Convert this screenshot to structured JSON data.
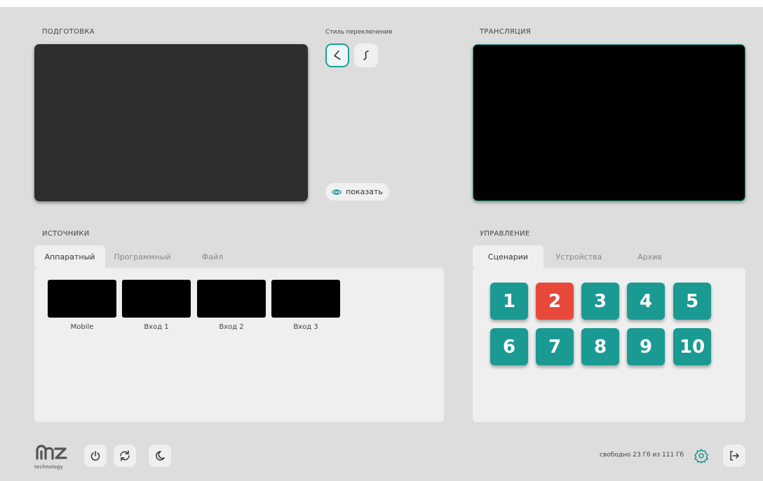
{
  "preview": {
    "label": "ПОДГОТОВКА"
  },
  "program": {
    "label": "ТРАНСЛЯЦИЯ"
  },
  "switch_style": {
    "label": "Стиль переключения",
    "options": [
      {
        "icon": "transition-cut-icon",
        "active": true
      },
      {
        "icon": "transition-fade-icon",
        "active": false
      }
    ]
  },
  "show_button": {
    "label": "показать",
    "icon": "eye-icon"
  },
  "sources": {
    "label": "ИСТОЧНИКИ",
    "tabs": [
      "Аппаратный",
      "Программный",
      "Файл"
    ],
    "active_tab": 0,
    "items": [
      "Mobile",
      "Вход 1",
      "Вход 2",
      "Вход 3"
    ]
  },
  "control": {
    "label": "УПРАВЛЕНИЕ",
    "tabs": [
      "Сценарии",
      "Устройства",
      "Архив"
    ],
    "active_tab": 0,
    "scenarios": [
      "1",
      "2",
      "3",
      "4",
      "5",
      "6",
      "7",
      "8",
      "9",
      "10"
    ],
    "active_scenario": "2"
  },
  "footer": {
    "logo_text": "technology",
    "storage_text": "свободно 23 Гб из 111 Гб",
    "buttons": [
      "power-icon",
      "refresh-icon",
      "moon-icon"
    ],
    "right_buttons": [
      "gear-icon",
      "logout-icon"
    ]
  },
  "colors": {
    "accent": "#1a9a93",
    "active_scenario": "#e8493a",
    "background": "#dddddd",
    "panel": "#efefef"
  }
}
